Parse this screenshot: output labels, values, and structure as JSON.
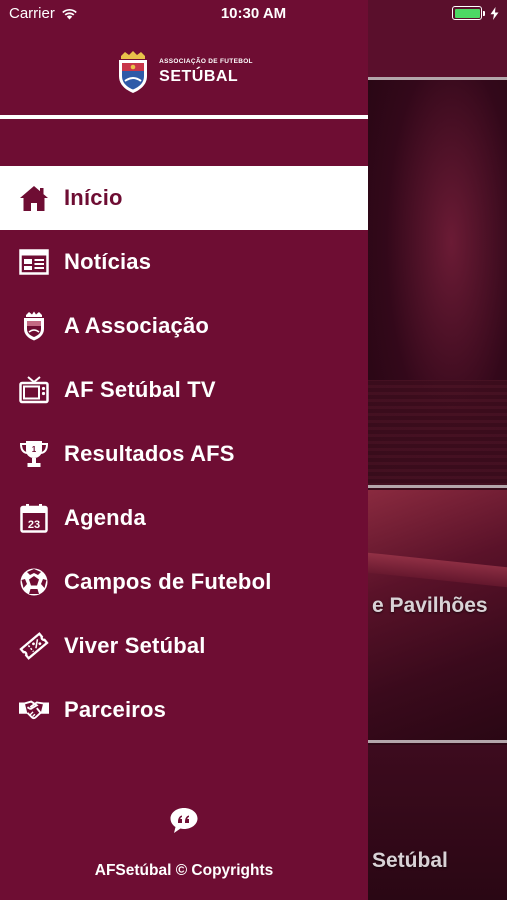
{
  "status_bar": {
    "carrier": "Carrier",
    "time": "10:30 AM"
  },
  "logo": {
    "small": "ASSOCIAÇÃO DE FUTEBOL",
    "big": "SETÚBAL"
  },
  "menu": {
    "items": [
      {
        "label": "Início",
        "icon": "home-icon",
        "active": true
      },
      {
        "label": "Notícias",
        "icon": "newspaper-icon"
      },
      {
        "label": "A Associação",
        "icon": "crest-icon"
      },
      {
        "label": "AF Setúbal TV",
        "icon": "tv-icon"
      },
      {
        "label": "Resultados AFS",
        "icon": "trophy-icon"
      },
      {
        "label": "Agenda",
        "icon": "calendar-icon",
        "calendar_day": "23"
      },
      {
        "label": "Campos de Futebol",
        "icon": "soccer-ball-icon"
      },
      {
        "label": "Viver Setúbal",
        "icon": "ticket-icon"
      },
      {
        "label": "Parceiros",
        "icon": "handshake-icon"
      }
    ]
  },
  "footer": {
    "copyright": "AFSetúbal © Copyrights",
    "icon": "quote-bubble-icon"
  },
  "background": {
    "label_1": "e Pavilhões",
    "label_2": "Setúbal"
  },
  "colors": {
    "drawer": "#6e0d33",
    "active_bg": "#ffffff",
    "text": "#ffffff",
    "battery": "#4cd964"
  }
}
